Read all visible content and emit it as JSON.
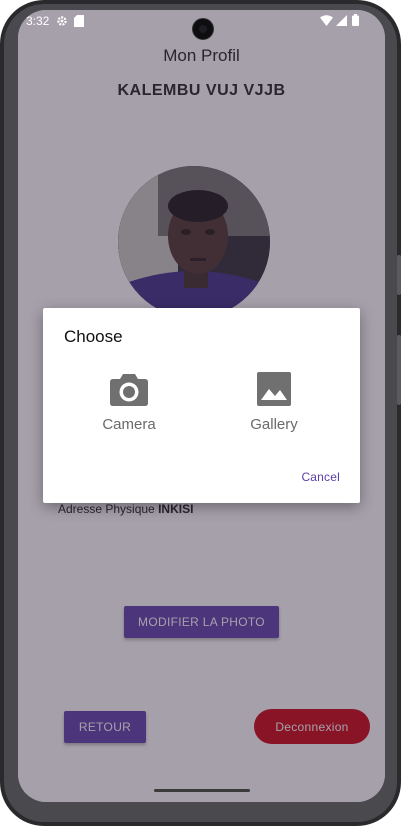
{
  "status_bar": {
    "time": "3:32",
    "left_icons": [
      "gear-icon",
      "sd-card-icon"
    ],
    "right_icons": [
      "wifi-icon",
      "signal-icon",
      "battery-icon"
    ]
  },
  "profile": {
    "title": "Mon Profil",
    "name": "KALEMBU  VUJ VJJB",
    "address_label": "Adresse Physique",
    "address_value": "INKISI"
  },
  "buttons": {
    "modify_photo": "MODIFIER LA PHOTO",
    "back": "RETOUR",
    "logout": "Deconnexion"
  },
  "dialog": {
    "title": "Choose",
    "options": [
      {
        "label": "Camera",
        "icon": "camera-icon"
      },
      {
        "label": "Gallery",
        "icon": "image-icon"
      }
    ],
    "cancel": "Cancel"
  },
  "colors": {
    "accent": "#5b3da6",
    "danger": "#c8000c",
    "scrim": "#3a2c44"
  }
}
